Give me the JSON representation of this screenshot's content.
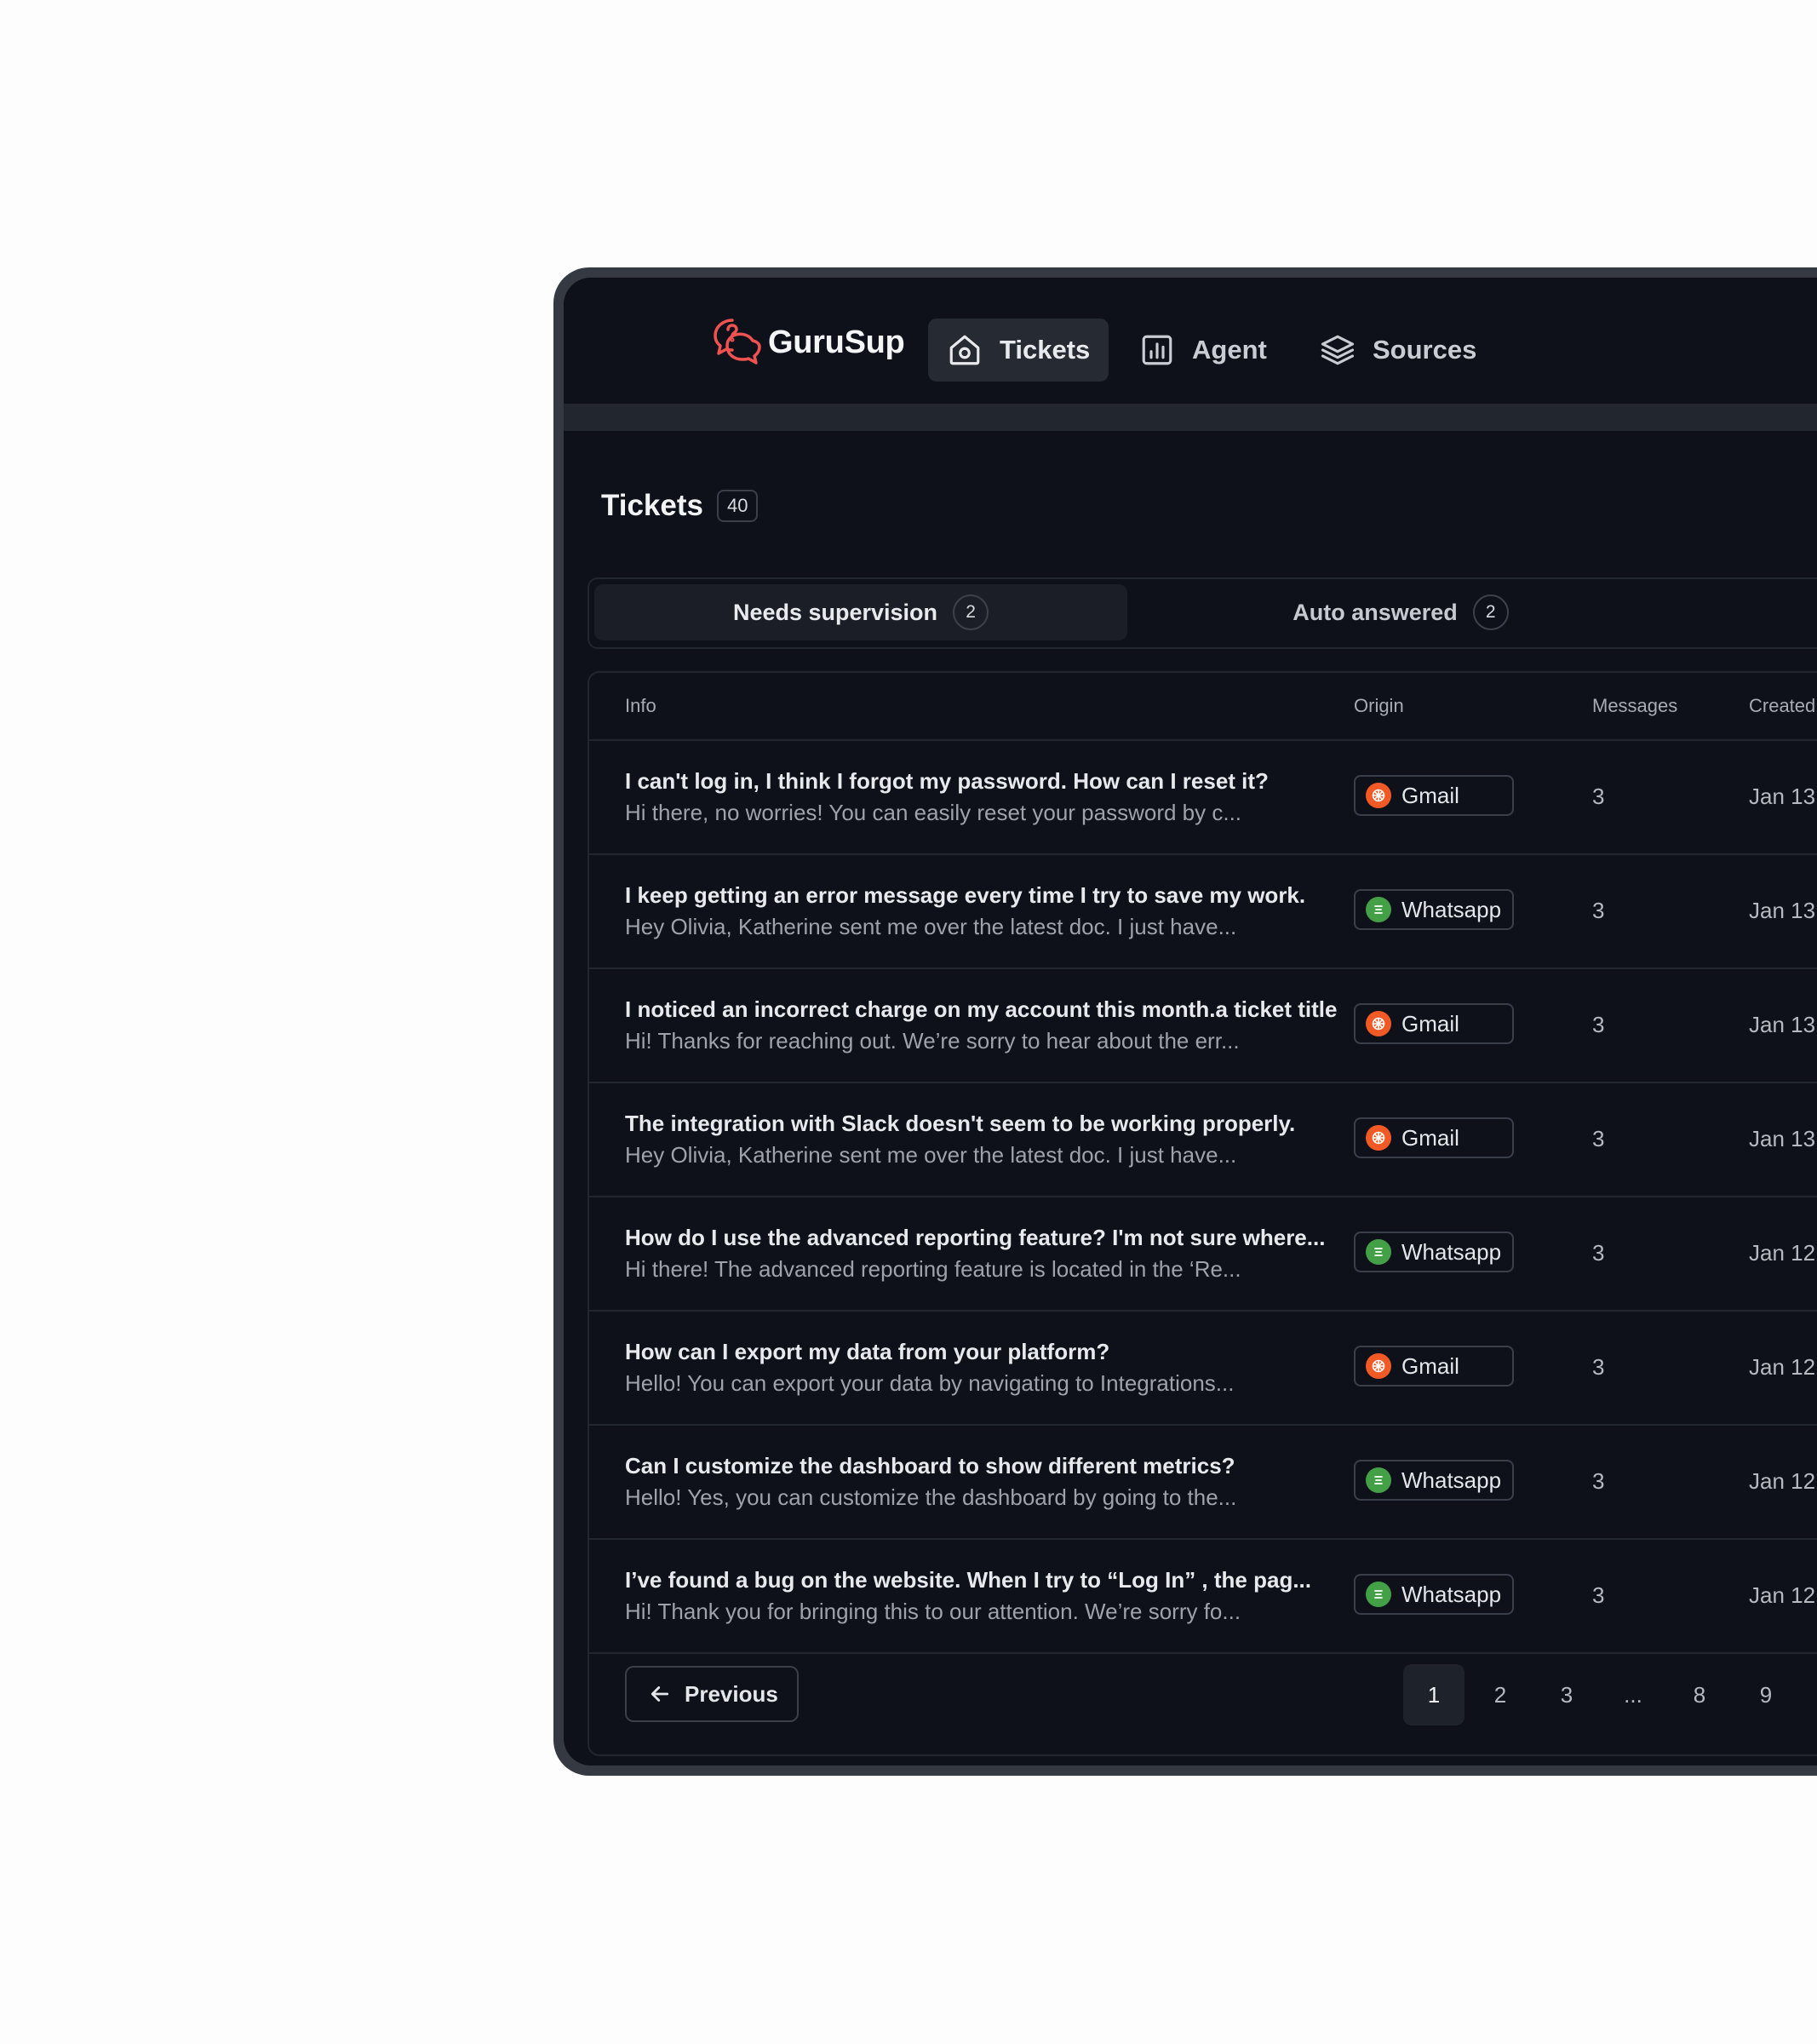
{
  "app": {
    "brand": "GuruSup",
    "nav": [
      {
        "label": "Tickets",
        "icon": "home-icon",
        "active": true
      },
      {
        "label": "Agent",
        "icon": "bar-chart-icon",
        "active": false
      },
      {
        "label": "Sources",
        "icon": "layers-icon",
        "active": false
      }
    ]
  },
  "page": {
    "title": "Tickets",
    "count": "40"
  },
  "tabs": [
    {
      "label": "Needs supervision",
      "count": "2",
      "active": true
    },
    {
      "label": "Auto answered",
      "count": "2",
      "active": false
    }
  ],
  "table": {
    "columns": {
      "info": "Info",
      "origin": "Origin",
      "messages": "Messages",
      "created": "Created"
    },
    "rows": [
      {
        "title": "I can't log in, I think I forgot my password. How can I reset it?",
        "preview": "Hi there, no worries! You can easily reset your password by c...",
        "origin": "Gmail",
        "messages": "3",
        "created": "Jan 13"
      },
      {
        "title": "I keep getting an error message every time I try to save my work.",
        "preview": "Hey Olivia, Katherine sent me over the latest doc. I just have...",
        "origin": "Whatsapp",
        "messages": "3",
        "created": "Jan 13"
      },
      {
        "title": "I noticed an incorrect charge on my account this month.a ticket title",
        "preview": "Hi! Thanks for reaching out. We’re sorry to hear about the err...",
        "origin": "Gmail",
        "messages": "3",
        "created": "Jan 13"
      },
      {
        "title": "The integration with Slack doesn't seem to be working properly.",
        "preview": "Hey Olivia, Katherine sent me over the latest doc. I just have...",
        "origin": "Gmail",
        "messages": "3",
        "created": "Jan 13"
      },
      {
        "title": "How do I use the advanced reporting feature? I'm not sure where...",
        "preview": "Hi there! The advanced reporting feature is located in the ‘Re...",
        "origin": "Whatsapp",
        "messages": "3",
        "created": "Jan 12"
      },
      {
        "title": "How can I export my data from your platform?",
        "preview": "Hello! You can export your data by navigating to Integrations...",
        "origin": "Gmail",
        "messages": "3",
        "created": "Jan 12"
      },
      {
        "title": "Can I customize the dashboard to show different metrics?",
        "preview": "Hello! Yes, you can customize the dashboard by going to the...",
        "origin": "Whatsapp",
        "messages": "3",
        "created": "Jan 12"
      },
      {
        "title": "I’ve found a bug on the website. When I try to “Log In” , the pag...",
        "preview": "Hi! Thank you for bringing this to our attention. We’re sorry fo...",
        "origin": "Whatsapp",
        "messages": "3",
        "created": "Jan 12"
      }
    ]
  },
  "pagination": {
    "previous_label": "Previous",
    "pages": [
      "1",
      "2",
      "3",
      "...",
      "8",
      "9"
    ],
    "current": "1"
  },
  "colors": {
    "brand_accent": "#f0524f",
    "gmail": "#f15a24",
    "whatsapp": "#43a047"
  }
}
